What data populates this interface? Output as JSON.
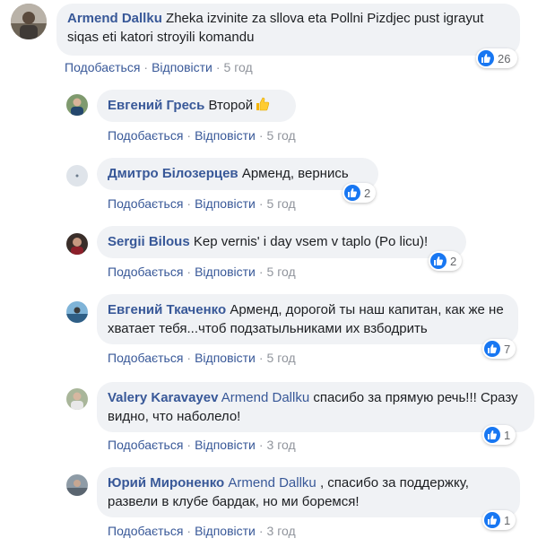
{
  "actions": {
    "like_label": "Подобається",
    "reply_label": "Відповісти",
    "separator": "·"
  },
  "comments": [
    {
      "author": "Armend Dallku",
      "text": "Zheka izvinite za sllova eta Pollni Pizdjec pust igrayut siqas eti katori stroyili komandu",
      "time": "5 год",
      "reactions": "26"
    },
    {
      "author": "Евгений Гресь",
      "text": "Второй",
      "emoji": "thumbs-up",
      "time": "5 год"
    },
    {
      "author": "Дмитро Білозерцев",
      "text": "Арменд, вернись",
      "time": "5 год",
      "reactions": "2"
    },
    {
      "author": "Sergii Bilous",
      "text": "Kep vernis' i day vsem v taplo (Po licu)!",
      "time": "5 год",
      "reactions": "2"
    },
    {
      "author": "Евгений Ткаченко",
      "text": "Арменд, дорогой ты наш капитан, как же не хватает тебя...чтоб подзатыльниками их взбодрить",
      "time": "5 год",
      "reactions": "7"
    },
    {
      "author": "Valery Karavayev",
      "mention": "Armend Dallku",
      "text": "спасибо за прямую речь!!! Сразу видно, что наболело!",
      "time": "3 год",
      "reactions": "1"
    },
    {
      "author": "Юрий Мироненко",
      "mention": "Armend Dallku",
      "text": ", спасибо за поддержку, развели в клубе бардак, но ми боремся!",
      "time": "3 год",
      "reactions": "1"
    }
  ],
  "colors": {
    "link": "#385898",
    "bubble": "#f0f2f5",
    "meta": "#90949c",
    "like": "#1877f2"
  }
}
